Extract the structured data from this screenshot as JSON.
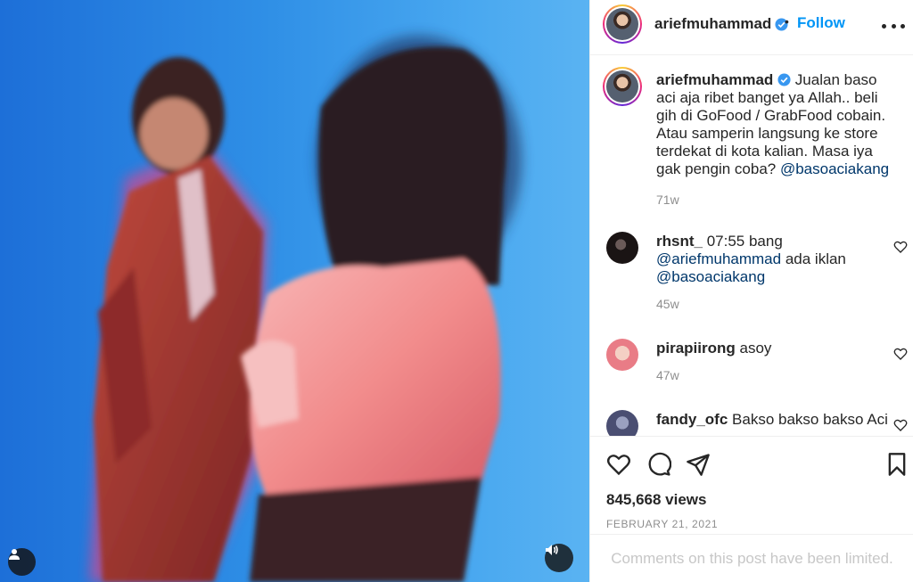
{
  "post": {
    "username": "ariefmuhammad",
    "dot": "•",
    "follow_label": "Follow",
    "more_icon": "more-options-icon"
  },
  "caption": {
    "username": "ariefmuhammad",
    "text": "Jualan baso aci aja ribet banget ya Allah.. beli gih di GoFood / GrabFood cobain. Atau samperin langsung ke store terdekat di kota kalian. Masa iya gak pengin coba? ",
    "mention": "@basoaciakang",
    "time": "71w"
  },
  "comments": [
    {
      "username": "rhsnt_",
      "text": "07:55 bang",
      "mention1": "@ariefmuhammad",
      "text2": "ada iklan",
      "mention2": "@basoaciakang",
      "time": "45w"
    },
    {
      "username": "pirapiirong",
      "text": "asoy",
      "time": "47w"
    },
    {
      "username": "fandy_ofc",
      "text": "Bakso bakso bakso Aci"
    }
  ],
  "stats": {
    "views": "845,668 views",
    "date": "FEBRUARY 21, 2021"
  },
  "footer": {
    "limited_text": "Comments on this post have been limited."
  },
  "colors": {
    "accent": "#0095f6",
    "mention": "#00376b",
    "muted": "#8e8e8e",
    "verified": "#3897f0"
  }
}
